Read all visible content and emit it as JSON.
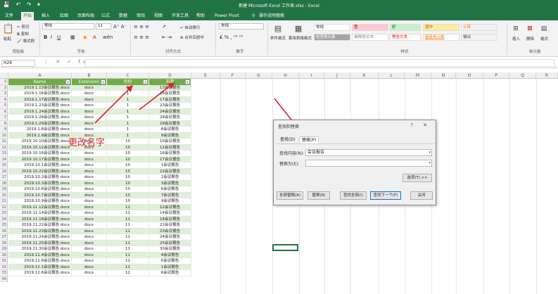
{
  "titlebar": {
    "title": "新建 Microsoft Excel 工作表.xlsx - Excel",
    "quick_access": "💾 ↶ ↷ ▾"
  },
  "tabs": [
    "文件",
    "开始",
    "插入",
    "绘图",
    "页面布局",
    "公式",
    "数据",
    "审阅",
    "视图",
    "开发工具",
    "帮助",
    "Power Pivot",
    "操作说明搜索"
  ],
  "ribbon": {
    "paste": "粘贴",
    "cut": "剪切",
    "copy": "复制",
    "format_painter": "格式刷",
    "clipboard": "剪贴板",
    "font_name": "等线",
    "font_size": "11",
    "font_group": "字体",
    "wrap": "自动换行",
    "merge": "合并后居中",
    "align_group": "对齐方式",
    "number_format": "常规",
    "number_group": "数字",
    "cond_format": "条件格式",
    "as_table": "套用表格格式",
    "styles": [
      "常规",
      "差",
      "好",
      "适中",
      "计算",
      "检查单元格",
      "解释性文本",
      "警告文本",
      "链接单元格",
      "输出"
    ],
    "styles_group": "样式",
    "insert": "插入",
    "delete": "删除",
    "format": "格式",
    "cells_group": "单元格"
  },
  "formula_bar": {
    "namebox": "H26",
    "icons": "⋮ ✕ ✓ fx"
  },
  "columns": [
    "A",
    "B",
    "C",
    "D",
    "E",
    "F",
    "G",
    "H",
    "I",
    "J",
    "K",
    "L",
    "M",
    "N",
    "O",
    "P",
    "Q",
    "R"
  ],
  "table_headers": [
    "Name",
    "Extension",
    "月份",
    "天数"
  ],
  "rows": [
    [
      "2019.1.13会议报告.docx",
      "docx",
      "1",
      "13会议报告"
    ],
    [
      "2019.1.16会议报告.docx",
      "docx",
      "1",
      "16会议报告"
    ],
    [
      "2019.1.17会议报告.docx",
      "docx",
      "1",
      "17会议报告"
    ],
    [
      "2019.1.23会议报告.docx",
      "docx",
      "1",
      "23会议报告"
    ],
    [
      "2019.1.24会议报告.docx",
      "docx",
      "1",
      "24会议报告"
    ],
    [
      "2019.1.28会议报告.docx",
      "docx",
      "1",
      "28会议报告"
    ],
    [
      "2019.1.29会议报告.docx",
      "docx",
      "1",
      "29会议报告"
    ],
    [
      "2019.1.8会议报告.docx",
      "docx",
      "1",
      "8会议报告"
    ],
    [
      "2019.1.9会议报告.docx",
      "docx",
      "1",
      "9会议报告"
    ],
    [
      "2019.10.10会议报告.docx",
      "docx",
      "10",
      "10会议报告"
    ],
    [
      "2019.10.12会议报告.docx",
      "docx",
      "10",
      "12会议报告"
    ],
    [
      "2019.10.16会议报告.docx",
      "docx",
      "10",
      "16会议报告"
    ],
    [
      "2019.10.17会议报告.docx",
      "docx",
      "10",
      "17会议报告"
    ],
    [
      "2019.10.1会议报告.docx",
      "docx",
      "10",
      "1会议报告"
    ],
    [
      "2019.10.22会议报告.docx",
      "docx",
      "10",
      "22会议报告"
    ],
    [
      "2019.10.2会议报告.docx",
      "docx",
      "10",
      "2会议报告"
    ],
    [
      "2019.10.3会议报告.docx",
      "docx",
      "10",
      "3会议报告"
    ],
    [
      "2019.10.6会议报告.docx",
      "docx",
      "10",
      "6会议报告"
    ],
    [
      "2019.10.7会议报告.docx",
      "docx",
      "10",
      "7会议报告"
    ],
    [
      "2019.10.9会议报告.docx",
      "docx",
      "10",
      "9会议报告"
    ],
    [
      "2019.11.12会议报告.docx",
      "docx",
      "11",
      "12会议报告"
    ],
    [
      "2019.11.14会议报告.docx",
      "docx",
      "11",
      "14会议报告"
    ],
    [
      "2019.11.18会议报告.docx",
      "docx",
      "11",
      "18会议报告"
    ],
    [
      "2019.11.22会议报告.docx",
      "docx",
      "11",
      "22会议报告"
    ],
    [
      "2019.11.23会议报告.docx",
      "docx",
      "11",
      "23会议报告"
    ],
    [
      "2019.11.24会议报告.docx",
      "docx",
      "11",
      "24会议报告"
    ],
    [
      "2019.11.25会议报告.docx",
      "docx",
      "11",
      "25会议报告"
    ],
    [
      "2019.11.30会议报告.docx",
      "docx",
      "11",
      "30会议报告"
    ],
    [
      "2019.11.4会议报告.docx",
      "docx",
      "11",
      "4会议报告"
    ],
    [
      "2019.11.6会议报告.docx",
      "docx",
      "11",
      "6会议报告"
    ],
    [
      "2019.12.1会议报告.docx",
      "docx",
      "12",
      "1会议报告"
    ],
    [
      "2019.12.6会议报告.docx",
      "docx",
      "12",
      "6会议报告"
    ]
  ],
  "annotation": "更改名字",
  "dialog": {
    "title": "查找和替换",
    "controls": "? ✕",
    "tab_find": "查找(D)",
    "tab_replace": "替换(P)",
    "find_label": "查找内容(N):",
    "find_value": "会议报告",
    "replace_label": "替换为(E):",
    "replace_value": "",
    "options_btn": "选项(T) >>",
    "btn_replace_all": "全部替换(A)",
    "btn_replace": "替换(R)",
    "btn_find_all": "查找全部(I)",
    "btn_find_next": "查找下一个(F)",
    "btn_close": "关闭"
  },
  "colors": {
    "excel_green": "#217346",
    "table_header": "#70ad47",
    "band": "#e2efda",
    "annotation": "#d8232a"
  }
}
